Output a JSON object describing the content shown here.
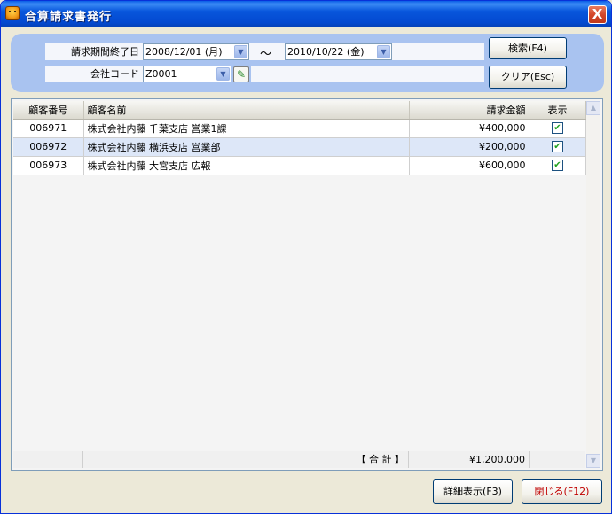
{
  "window": {
    "title": "合算請求書発行",
    "close_label": "X"
  },
  "search": {
    "period_label": "請求期間終了日",
    "date_from": "2008/12/01 (月)",
    "range_sep": "～",
    "date_to": "2010/10/22 (金)",
    "company_label": "会社コード",
    "company_code": "Z0001",
    "search_button": "検索(F4)",
    "clear_button": "クリア(Esc)"
  },
  "table": {
    "headers": [
      "顧客番号",
      "顧客名前",
      "請求金額",
      "表示"
    ],
    "rows": [
      {
        "id": "006971",
        "name": "株式会社内藤 千葉支店 営業1課",
        "amount": "¥400,000",
        "shown": true
      },
      {
        "id": "006972",
        "name": "株式会社内藤 横浜支店 営業部",
        "amount": "¥200,000",
        "shown": true
      },
      {
        "id": "006973",
        "name": "株式会社内藤 大宮支店 広報",
        "amount": "¥600,000",
        "shown": true
      }
    ],
    "total_label": "【 合 計 】",
    "total_amount": "¥1,200,000"
  },
  "buttons": {
    "detail": "詳細表示(F3)",
    "close": "閉じる(F12)"
  },
  "colors": {
    "title_bar": "#0856dc",
    "search_panel": "#a9c3f0",
    "close_button_text": "#c00000"
  }
}
